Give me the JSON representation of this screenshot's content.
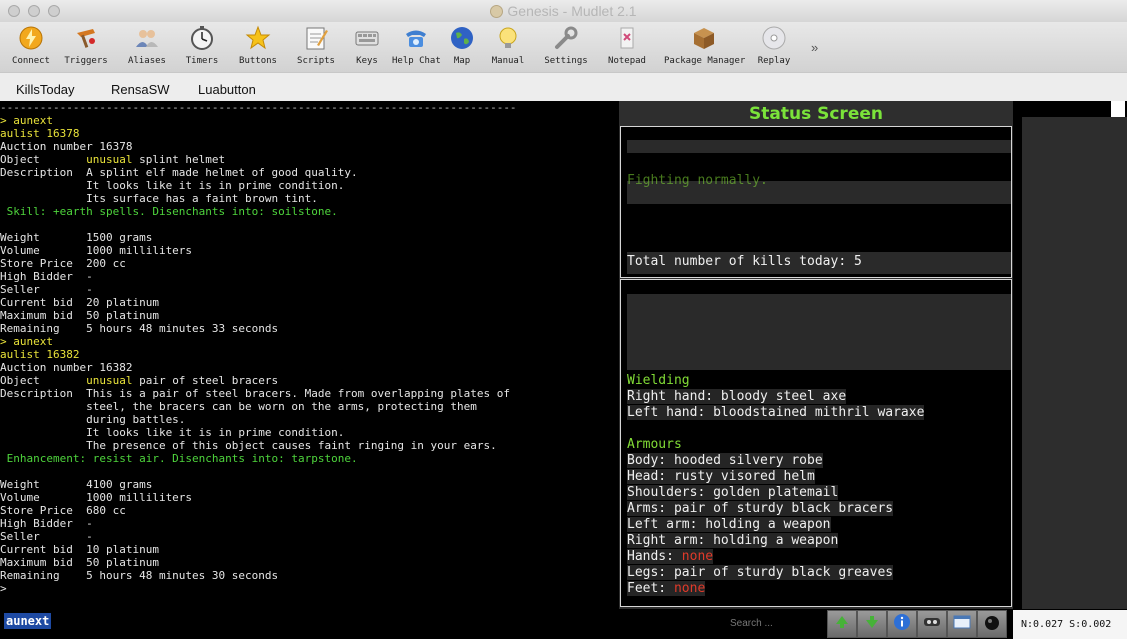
{
  "window": {
    "title": "Genesis - Mudlet 2.1"
  },
  "toolbar": {
    "items": [
      {
        "label": "Connect",
        "icon": "connect-icon"
      },
      {
        "label": "Triggers",
        "icon": "triggers-icon"
      },
      {
        "label": "Aliases",
        "icon": "aliases-icon"
      },
      {
        "label": "Timers",
        "icon": "timers-icon"
      },
      {
        "label": "Buttons",
        "icon": "buttons-icon"
      },
      {
        "label": "Scripts",
        "icon": "scripts-icon"
      },
      {
        "label": "Keys",
        "icon": "keys-icon"
      },
      {
        "label": "Help Chat",
        "icon": "help-chat-icon"
      },
      {
        "label": "Map",
        "icon": "map-icon"
      },
      {
        "label": "Manual",
        "icon": "manual-icon"
      },
      {
        "label": "Settings",
        "icon": "settings-icon"
      },
      {
        "label": "Notepad",
        "icon": "notepad-icon"
      },
      {
        "label": "Package Manager",
        "icon": "package-manager-icon"
      },
      {
        "label": "Replay",
        "icon": "replay-icon"
      }
    ],
    "more": "»"
  },
  "tabs": [
    "KillsToday",
    "RensaSW",
    "Luabutton"
  ],
  "console": {
    "lines": [
      {
        "t": "------------------------------------------------------------------------------",
        "c": "hr"
      },
      {
        "t": "> aunext",
        "c": "yl"
      },
      {
        "t": "aulist 16378",
        "c": "yl"
      },
      {
        "t": "Auction number 16378",
        "c": ""
      },
      {
        "t": "Object       |unusual| splint helmet",
        "c": "obj"
      },
      {
        "t": "Description  A splint elf made helmet of good quality.",
        "c": ""
      },
      {
        "t": "             It looks like it is in prime condition.",
        "c": ""
      },
      {
        "t": "             Its surface has a faint brown tint.",
        "c": ""
      },
      {
        "t": " Skill: +earth spells. Disenchants into: soilstone.",
        "c": "gr"
      },
      {
        "t": "",
        "c": ""
      },
      {
        "t": "Weight       1500 grams",
        "c": ""
      },
      {
        "t": "Volume       1000 milliliters",
        "c": ""
      },
      {
        "t": "Store Price  200 cc",
        "c": ""
      },
      {
        "t": "High Bidder  -",
        "c": ""
      },
      {
        "t": "Seller       -",
        "c": ""
      },
      {
        "t": "Current bid  20 platinum",
        "c": ""
      },
      {
        "t": "Maximum bid  50 platinum",
        "c": ""
      },
      {
        "t": "Remaining    5 hours 48 minutes 33 seconds",
        "c": ""
      },
      {
        "t": "> aunext",
        "c": "yl"
      },
      {
        "t": "aulist 16382",
        "c": "yl"
      },
      {
        "t": "Auction number 16382",
        "c": ""
      },
      {
        "t": "Object       |unusual| pair of steel bracers",
        "c": "obj"
      },
      {
        "t": "Description  This is a pair of steel bracers. Made from overlapping plates of",
        "c": ""
      },
      {
        "t": "             steel, the bracers can be worn on the arms, protecting them",
        "c": ""
      },
      {
        "t": "             during battles.",
        "c": ""
      },
      {
        "t": "             It looks like it is in prime condition.",
        "c": ""
      },
      {
        "t": "             The presence of this object causes faint ringing in your ears.",
        "c": ""
      },
      {
        "t": " Enhancement: resist air. Disenchants into: tarpstone.",
        "c": "gr"
      },
      {
        "t": "",
        "c": ""
      },
      {
        "t": "Weight       4100 grams",
        "c": ""
      },
      {
        "t": "Volume       1000 milliliters",
        "c": ""
      },
      {
        "t": "Store Price  680 cc",
        "c": ""
      },
      {
        "t": "High Bidder  -",
        "c": ""
      },
      {
        "t": "Seller       -",
        "c": ""
      },
      {
        "t": "Current bid  10 platinum",
        "c": ""
      },
      {
        "t": "Maximum bid  50 platinum",
        "c": ""
      },
      {
        "t": "Remaining    5 hours 48 minutes 30 seconds",
        "c": ""
      },
      {
        "t": ">",
        "c": ""
      }
    ]
  },
  "status": {
    "title": "Status Screen",
    "fighting": "Fighting normally.",
    "kills": "Total number of kills today: 5",
    "wielding_header": "Wielding",
    "right_hand": "Right hand: bloody steel axe",
    "left_hand": "Left hand: bloodstained mithril waraxe",
    "armours_header": "Armours",
    "body": "Body: hooded silvery robe",
    "head": "Head: rusty visored helm",
    "shoulders": "Shoulders: golden platemail",
    "arms": "Arms: pair of sturdy black bracers",
    "left_arm": "Left arm: holding a weapon",
    "right_arm": "Right arm: holding a weapon",
    "hands_label": "Hands: ",
    "hands_value": "none",
    "legs": "Legs: pair of sturdy black greaves",
    "feet_label": "Feet: ",
    "feet_value": "none"
  },
  "bottom": {
    "command": "aunext",
    "search_placeholder": "Search ...",
    "stats": "N:0.027 S:0.002"
  },
  "colors": {
    "console_yellow": "#e9e33a",
    "console_green": "#4ed43c",
    "status_title_green": "#7be33a",
    "none_red": "#e03a2a",
    "command_highlight": "#1e4aa3"
  }
}
